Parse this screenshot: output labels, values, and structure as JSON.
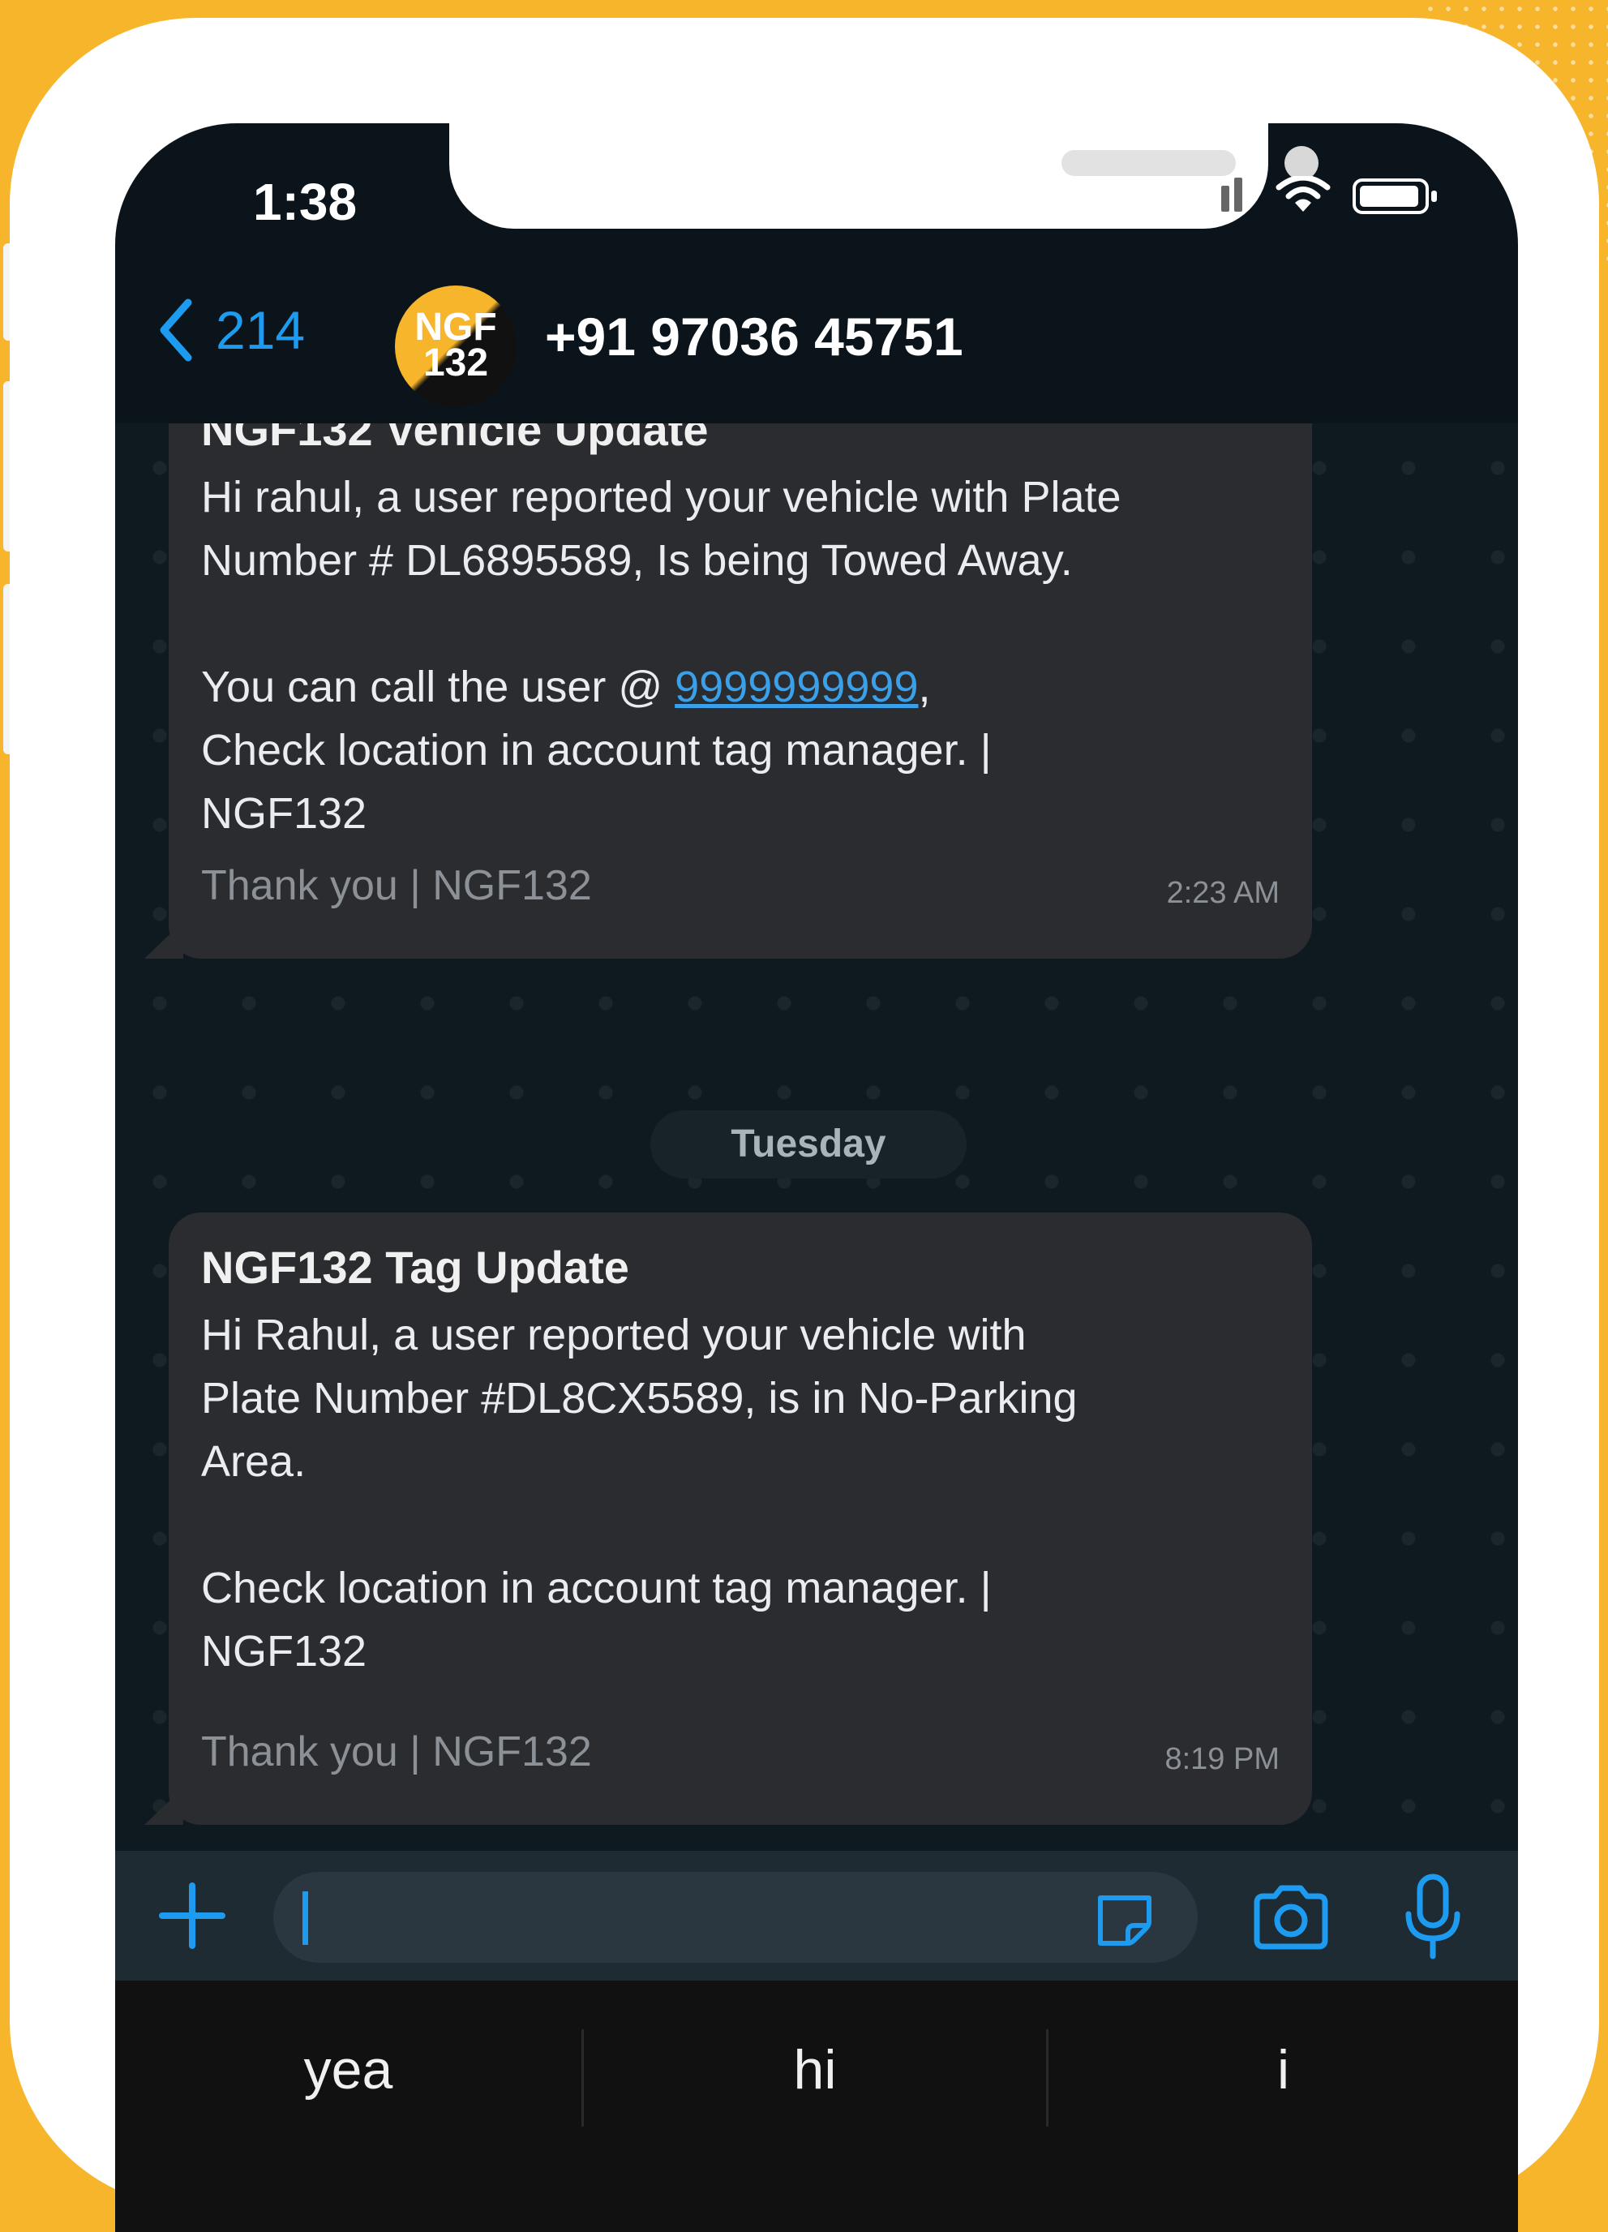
{
  "status_bar": {
    "time": "1:38"
  },
  "header": {
    "back_count": "214",
    "avatar_text_line1": "NGF",
    "avatar_text_line2": "132",
    "contact_name": "+91 97036 45751"
  },
  "messages": [
    {
      "title": "NGF132 Vehicle Update",
      "body_part1": "Hi rahul, a user reported your vehicle with Plate\nNumber # DL6895589,  Is being Towed Away.\n\nYou can call the user @  ",
      "link_text": "9999999999",
      "body_part2": ",\nCheck location in account tag manager. |\nNGF132",
      "footer": "Thank you | NGF132",
      "time": "2:23 AM"
    },
    {
      "title": "NGF132 Tag Update",
      "body": "Hi Rahul, a user reported your vehicle with\nPlate Number #DL8CX5589, is in No-Parking\nArea.\n\nCheck location in account tag manager. |\nNGF132",
      "footer": "Thank you | NGF132",
      "time": "8:19 PM"
    }
  ],
  "date_separator": "Tuesday",
  "input": {
    "value": ""
  },
  "suggestions": [
    "yea",
    "hi",
    "i"
  ],
  "colors": {
    "accent": "#1d9bf0",
    "frame_bg": "#F7B52B",
    "bubble": "#2b2c2f"
  }
}
